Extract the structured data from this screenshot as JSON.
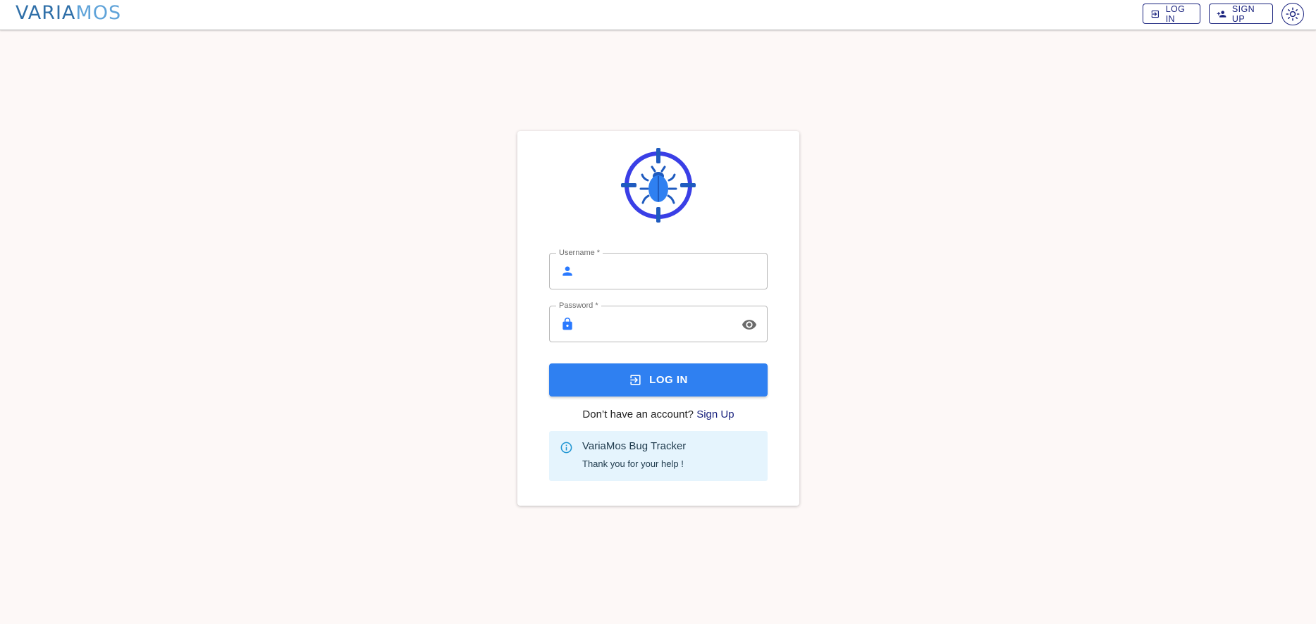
{
  "header": {
    "logo_text_1": "VARIA",
    "logo_text_2": "MOS",
    "login_label": "LOG IN",
    "signup_label": "SIGN UP"
  },
  "form": {
    "username_label": "Username *",
    "password_label": "Password *",
    "username_value": "",
    "password_value": "",
    "login_button_label": "LOG IN",
    "signup_prompt": "Don’t have an account?",
    "signup_link": "Sign Up"
  },
  "info": {
    "title": "VariaMos Bug Tracker",
    "text": "Thank you for your help !"
  },
  "icons": {
    "login": "login-icon",
    "signup": "person-add-icon",
    "theme": "sun-icon",
    "brand": "bug-target-icon",
    "user": "person-icon",
    "lock": "lock-icon",
    "eye": "eye-icon",
    "info": "info-icon"
  },
  "colors": {
    "primary": "#2f80f1",
    "nav_dark": "#1a237e",
    "info_bg": "#e5f4fd",
    "page_bg": "#fdf8f7"
  }
}
